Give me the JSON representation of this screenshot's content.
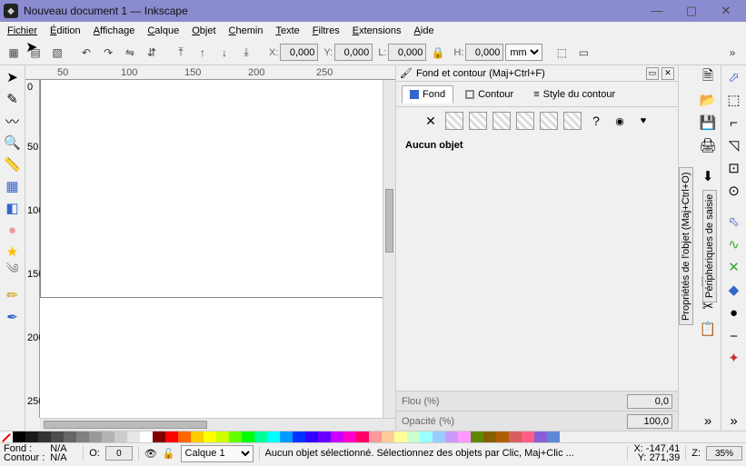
{
  "title": "Nouveau document 1 — Inkscape",
  "menu": [
    "Fichier",
    "Édition",
    "Affichage",
    "Calque",
    "Objet",
    "Chemin",
    "Texte",
    "Filtres",
    "Extensions",
    "Aide"
  ],
  "coords": {
    "x_label": "X:",
    "x": "0,000",
    "y_label": "Y:",
    "y": "0,000",
    "w_label": "L:",
    "w": "0,000",
    "h_label": "H:",
    "h": "0,000",
    "unit": "mm"
  },
  "dock": {
    "title": "Fond et contour (Maj+Ctrl+F)",
    "tabs": {
      "fill": "Fond",
      "stroke": "Contour",
      "stroke_style": "Style du contour"
    },
    "nofill_tooltip": "Pas de remplissage",
    "unknown": "?",
    "message": "Aucun objet",
    "blur_label": "Flou (%)",
    "blur_value": "0,0",
    "opacity_label": "Opacité (%)",
    "opacity_value": "100,0"
  },
  "side_tabs": [
    "Propriétés de l'objet (Maj+Ctrl+O)",
    "Périphériques de saisie"
  ],
  "ruler_h": {
    "m50": "50",
    "m100": "100",
    "m150": "150",
    "m200": "200",
    "m250": "250"
  },
  "ruler_v": {
    "v0": "0",
    "v50": "50",
    "v100": "100",
    "v150": "150",
    "v200": "200",
    "v250": "250"
  },
  "palette": [
    "#000000",
    "#1a1a1a",
    "#333333",
    "#4d4d4d",
    "#666666",
    "#808080",
    "#999999",
    "#b3b3b3",
    "#cccccc",
    "#e6e6e6",
    "#ffffff",
    "#800000",
    "#ff0000",
    "#ff6600",
    "#ffcc00",
    "#ffff00",
    "#ccff00",
    "#66ff00",
    "#00ff00",
    "#00ff99",
    "#00ffff",
    "#0099ff",
    "#0033ff",
    "#3300ff",
    "#6600ff",
    "#cc00ff",
    "#ff00cc",
    "#ff0066",
    "#ff9999",
    "#ffcc99",
    "#ffff99",
    "#ccffcc",
    "#99ffff",
    "#99ccff",
    "#cc99ff",
    "#ff99ff",
    "#5f8700",
    "#875f00",
    "#af5f00",
    "#d75f5f",
    "#ff5f87",
    "#875fd7",
    "#5f87d7"
  ],
  "status": {
    "fill_label": "Fond :",
    "fill_val": "N/A",
    "stroke_label": "Contour :",
    "stroke_val": "N/A",
    "o_label": "O:",
    "o_val": "0",
    "layer": "Calque 1",
    "message": "Aucun objet sélectionné. Sélectionnez des objets par Clic, Maj+Clic ...",
    "x_label": "X:",
    "x": "-147,41",
    "y_label": "Y:",
    "y": "271,39",
    "z_label": "Z:",
    "z": "35%"
  }
}
